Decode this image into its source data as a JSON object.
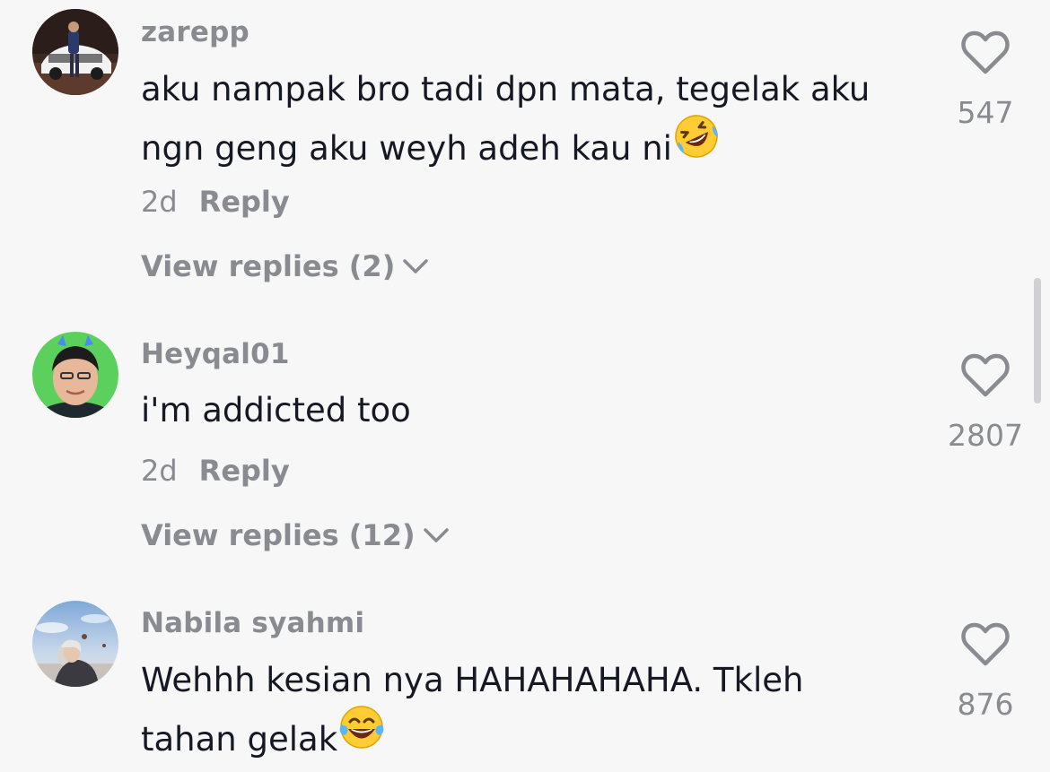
{
  "comments": [
    {
      "username": "zarepp",
      "text_line1": "aku nampak bro tadi dpn mata, tegelak aku",
      "text_line2": "ngn geng aku weyh adeh kau ni",
      "time": "2d",
      "reply_label": "Reply",
      "view_replies": "View replies (2)",
      "likes": "547",
      "emoji": "rolling-on-floor-laughing-emoji"
    },
    {
      "username": "Heyqal01",
      "text_line1": "i'm addicted too",
      "time": "2d",
      "reply_label": "Reply",
      "view_replies": "View replies (12)",
      "likes": "2807"
    },
    {
      "username": "Nabila syahmi",
      "text_line1": "Wehhh kesian nya HAHAHAHAHA. Tkleh",
      "text_line2": "tahan gelak",
      "likes": "876",
      "emoji": "face-with-tears-of-joy-emoji"
    }
  ],
  "icons": {
    "like": "heart-outline-icon",
    "expand": "chevron-down-icon"
  },
  "colors": {
    "background": "#f7f7f7",
    "text": "#161823",
    "secondary": "#8a8b91"
  }
}
